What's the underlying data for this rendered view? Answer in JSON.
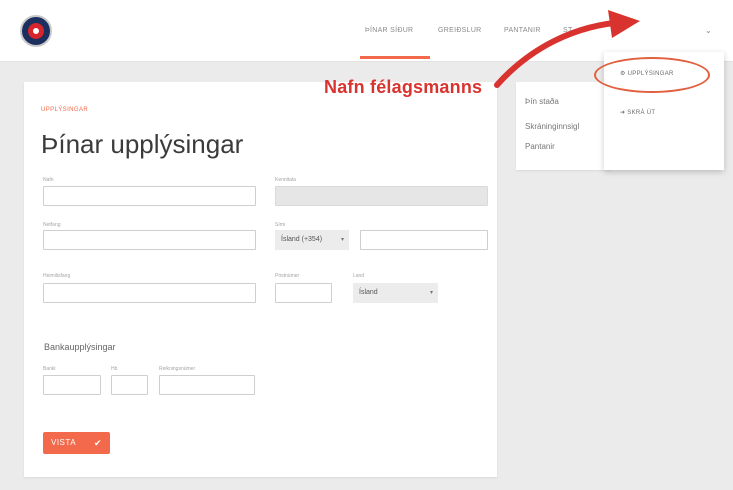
{
  "nav": {
    "items": [
      "ÞÍNAR SÍÐUR",
      "GREIÐSLUR",
      "PANTANIR",
      "ST"
    ],
    "chevron": "⌄"
  },
  "form": {
    "overline": "UPPLÝSINGAR",
    "title": "Þínar upplýsingar",
    "fields": {
      "name_label": "Nafn",
      "kennitala_label": "Kennitala",
      "netfang_label": "Netfang",
      "simi_label": "Sími",
      "simi_country": "Ísland (+354)",
      "heimilisfang_label": "Heimilisfang",
      "postnumer_label": "Póstnúmer",
      "land_label": "Land",
      "land_value": "Ísland"
    },
    "bank_title": "Bankaupplýsingar",
    "bank_fields": {
      "banki_label": "Banki",
      "hb_label": "Hb",
      "reikningsnumer_label": "Reikningsnúmer"
    },
    "save_label": "VISTA",
    "save_icon": "✔"
  },
  "side_menu": {
    "items": [
      "Þín staða",
      "Skráninginnsigl",
      "Pantanir"
    ]
  },
  "dropdown": {
    "items": [
      "⚙ UPPLÝSINGAR",
      "➜ SKRÁ ÚT"
    ]
  },
  "annotation": {
    "text": "Nafn félagsmanns",
    "color": "#d9332f"
  },
  "colors": {
    "accent": "#f26a4b",
    "background": "#ebebeb"
  }
}
